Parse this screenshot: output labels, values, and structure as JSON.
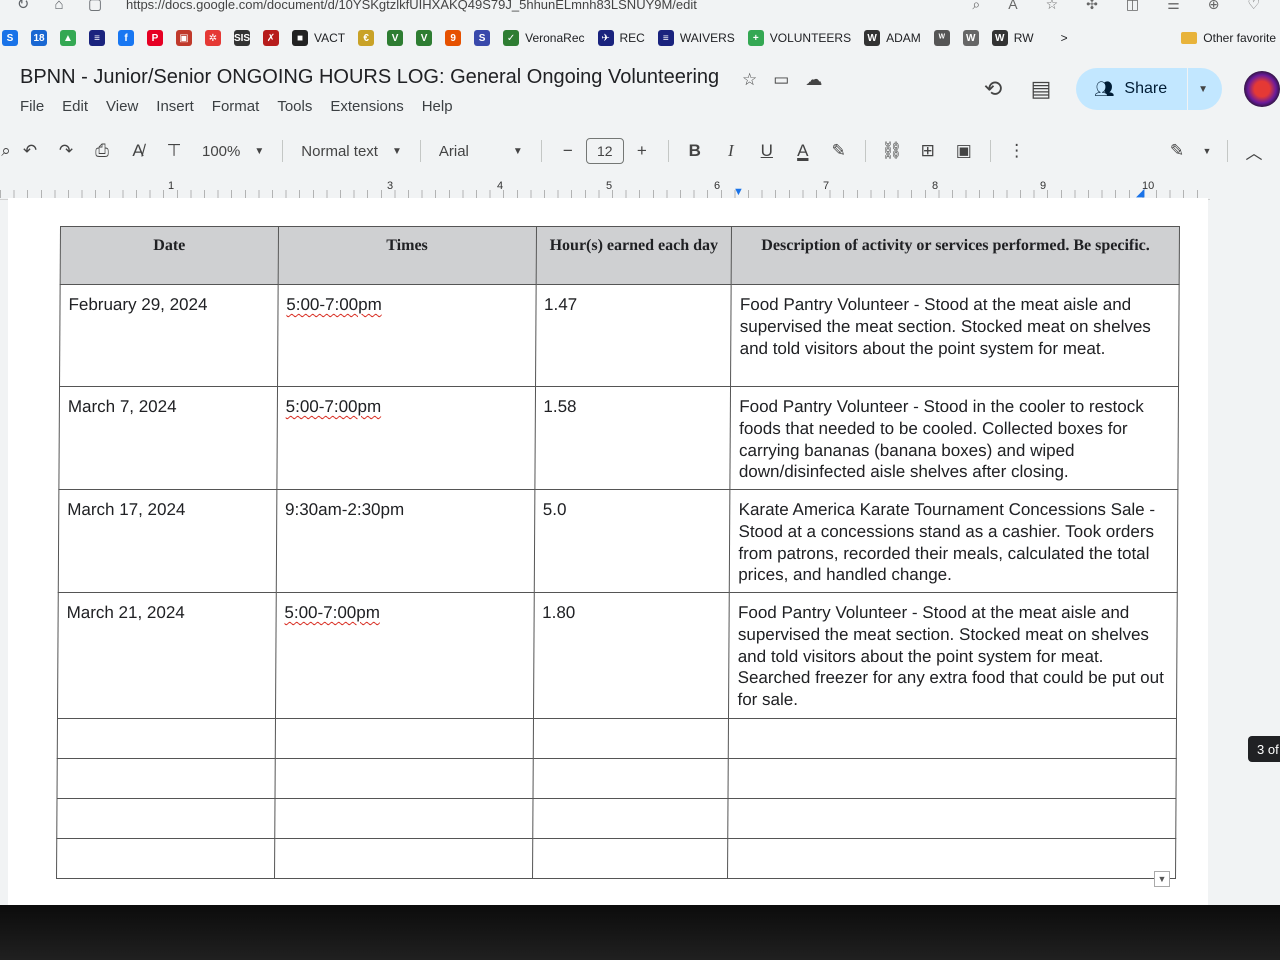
{
  "browser": {
    "url": "https://docs.google.com/document/d/10YSKgtzlkfUIHXAKQ49S79J_5hhunELmnh83LSNUY9M/edit"
  },
  "bookmarks": [
    {
      "label": "",
      "color": "#1a73e8",
      "glyph": "S"
    },
    {
      "label": "",
      "color": "#1967d2",
      "glyph": "18"
    },
    {
      "label": "",
      "color": "#34a853",
      "glyph": "▲"
    },
    {
      "label": "",
      "color": "#1a237e",
      "glyph": "≡"
    },
    {
      "label": "",
      "color": "#1877f2",
      "glyph": "f"
    },
    {
      "label": "",
      "color": "#e60023",
      "glyph": "P"
    },
    {
      "label": "",
      "color": "#c0392b",
      "glyph": "▣"
    },
    {
      "label": "",
      "color": "#e53935",
      "glyph": "✲"
    },
    {
      "label": "",
      "color": "#333333",
      "glyph": "SIS"
    },
    {
      "label": "",
      "color": "#b71c1c",
      "glyph": "✗"
    },
    {
      "label": "VACT",
      "color": "#222222",
      "glyph": "■"
    },
    {
      "label": "",
      "color": "#c9a227",
      "glyph": "€"
    },
    {
      "label": "",
      "color": "#2e7d32",
      "glyph": "V"
    },
    {
      "label": "",
      "color": "#2e7d32",
      "glyph": "V"
    },
    {
      "label": "",
      "color": "#e65100",
      "glyph": "9"
    },
    {
      "label": "",
      "color": "#3949ab",
      "glyph": "S"
    },
    {
      "label": "VeronaRec",
      "color": "#2e7d32",
      "glyph": "✓"
    },
    {
      "label": "REC",
      "color": "#1a237e",
      "glyph": "✈"
    },
    {
      "label": "WAIVERS",
      "color": "#1a237e",
      "glyph": "≡"
    },
    {
      "label": "VOLUNTEERS",
      "color": "#34a853",
      "glyph": "+"
    },
    {
      "label": "ADAM",
      "color": "#333333",
      "glyph": "W"
    },
    {
      "label": "",
      "color": "#555555",
      "glyph": "ᵂ"
    },
    {
      "label": "",
      "color": "#666666",
      "glyph": "W"
    },
    {
      "label": "RW",
      "color": "#333333",
      "glyph": "W"
    }
  ],
  "bookmarks_more": ">",
  "other_favorites": "Other favorite",
  "doc": {
    "title": "BPNN - Junior/Senior ONGOING HOURS LOG: General Ongoing Volunteering",
    "share_label": "Share"
  },
  "menu": [
    "File",
    "Edit",
    "View",
    "Insert",
    "Format",
    "Tools",
    "Extensions",
    "Help"
  ],
  "toolbar": {
    "zoom": "100%",
    "style": "Normal text",
    "font": "Arial",
    "font_size": "12",
    "bold": "B",
    "italic": "I",
    "underline": "U",
    "text_color": "A",
    "minus": "−",
    "plus": "+"
  },
  "ruler_numbers": [
    "1",
    "3",
    "4",
    "5",
    "6",
    "7",
    "8",
    "9",
    "10"
  ],
  "table": {
    "headers": [
      "Date",
      "Times",
      "Hour(s) earned each day",
      "Description of activity or services performed. Be specific."
    ],
    "rows": [
      {
        "date": "February 29, 2024",
        "times": "5:00-7:00pm",
        "hours": "1.47",
        "description": "Food Pantry Volunteer - Stood at the meat aisle and supervised the meat section. Stocked meat on shelves and told visitors about the point system for meat."
      },
      {
        "date": "March 7, 2024",
        "times": "5:00-7:00pm",
        "hours": "1.58",
        "description": "Food Pantry Volunteer - Stood in the cooler to restock foods that needed to be cooled. Collected boxes for carrying bananas (banana boxes) and wiped down/disinfected aisle shelves after closing."
      },
      {
        "date": "March 17, 2024",
        "times": "9:30am-2:30pm",
        "hours": "5.0",
        "description": "Karate America Karate Tournament Concessions Sale - Stood at a concessions stand as a cashier. Took orders from patrons, recorded their meals, calculated the total prices, and handled change."
      },
      {
        "date": "March 21, 2024",
        "times": "5:00-7:00pm",
        "hours": "1.80",
        "description": "Food Pantry Volunteer - Stood at the meat aisle and supervised the meat section. Stocked meat on shelves and told visitors about the point system for meat. Searched freezer for any extra food that could be put out for sale."
      }
    ]
  },
  "page_indicator": "3 of"
}
